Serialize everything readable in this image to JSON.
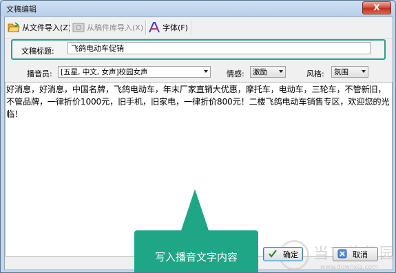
{
  "window": {
    "title": "文稿编辑",
    "close_symbol": "X"
  },
  "toolbar": {
    "import_file": {
      "label": "从文件导入(Z)",
      "icon": "folder-open-icon"
    },
    "import_library": {
      "label": "从稿件库导入(X)",
      "icon": "library-import-icon",
      "disabled": true
    },
    "font": {
      "label": "字体(F)",
      "icon": "font-icon"
    }
  },
  "title_field": {
    "label": "文稿标题:",
    "value": "飞鸽电动车促销"
  },
  "settings": {
    "announcer_label": "播音员:",
    "announcer_value": "[五星, 中文, 女声]校园女声",
    "emotion_label": "情感:",
    "emotion_value": "激励",
    "style_label": "风格:",
    "style_value": "氛围"
  },
  "content": "好消息，好消息，中国名牌，飞鸽电动车，年末厂家直销大优惠，摩托车，电动车，三轮车，不管新旧，不管品牌，一律折价1000元，旧手机，旧家电，一律折价800元！二楼飞鸽电动车销售专区，欢迎您的光临！",
  "callout": {
    "text": "写入播音文字内容",
    "color": "#1fa687"
  },
  "buttons": {
    "ok_label": "确定",
    "cancel_label": "取消"
  },
  "watermark": {
    "text": "当下软件园",
    "url": "www.downxia.com"
  }
}
